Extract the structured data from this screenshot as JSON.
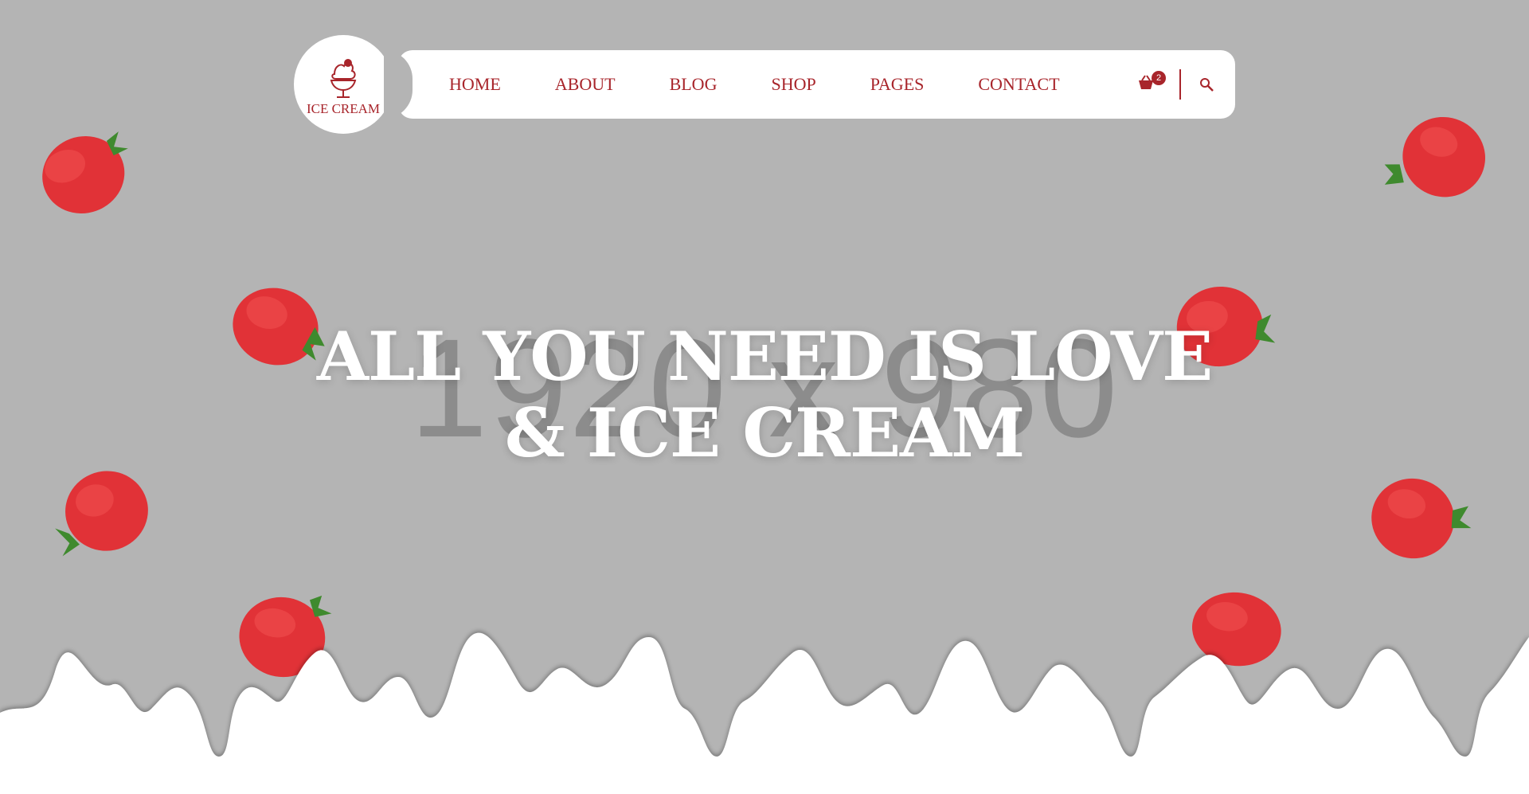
{
  "brand": {
    "logo_text": "ICE CREAM"
  },
  "nav": {
    "items": [
      {
        "label": "HOME"
      },
      {
        "label": "ABOUT"
      },
      {
        "label": "BLOG"
      },
      {
        "label": "SHOP"
      },
      {
        "label": "PAGES"
      },
      {
        "label": "CONTACT"
      }
    ],
    "cart_count": "2"
  },
  "hero": {
    "placeholder_text": "1920 x 980",
    "headline_line1": "ALL YOU NEED IS LOVE",
    "headline_line2": "& ICE CREAM"
  },
  "colors": {
    "accent": "#a8252b",
    "background": "#b4b4b4",
    "white": "#ffffff"
  },
  "icons": {
    "logo": "ice-cream-icon",
    "cart": "basket-icon",
    "search": "search-icon"
  }
}
